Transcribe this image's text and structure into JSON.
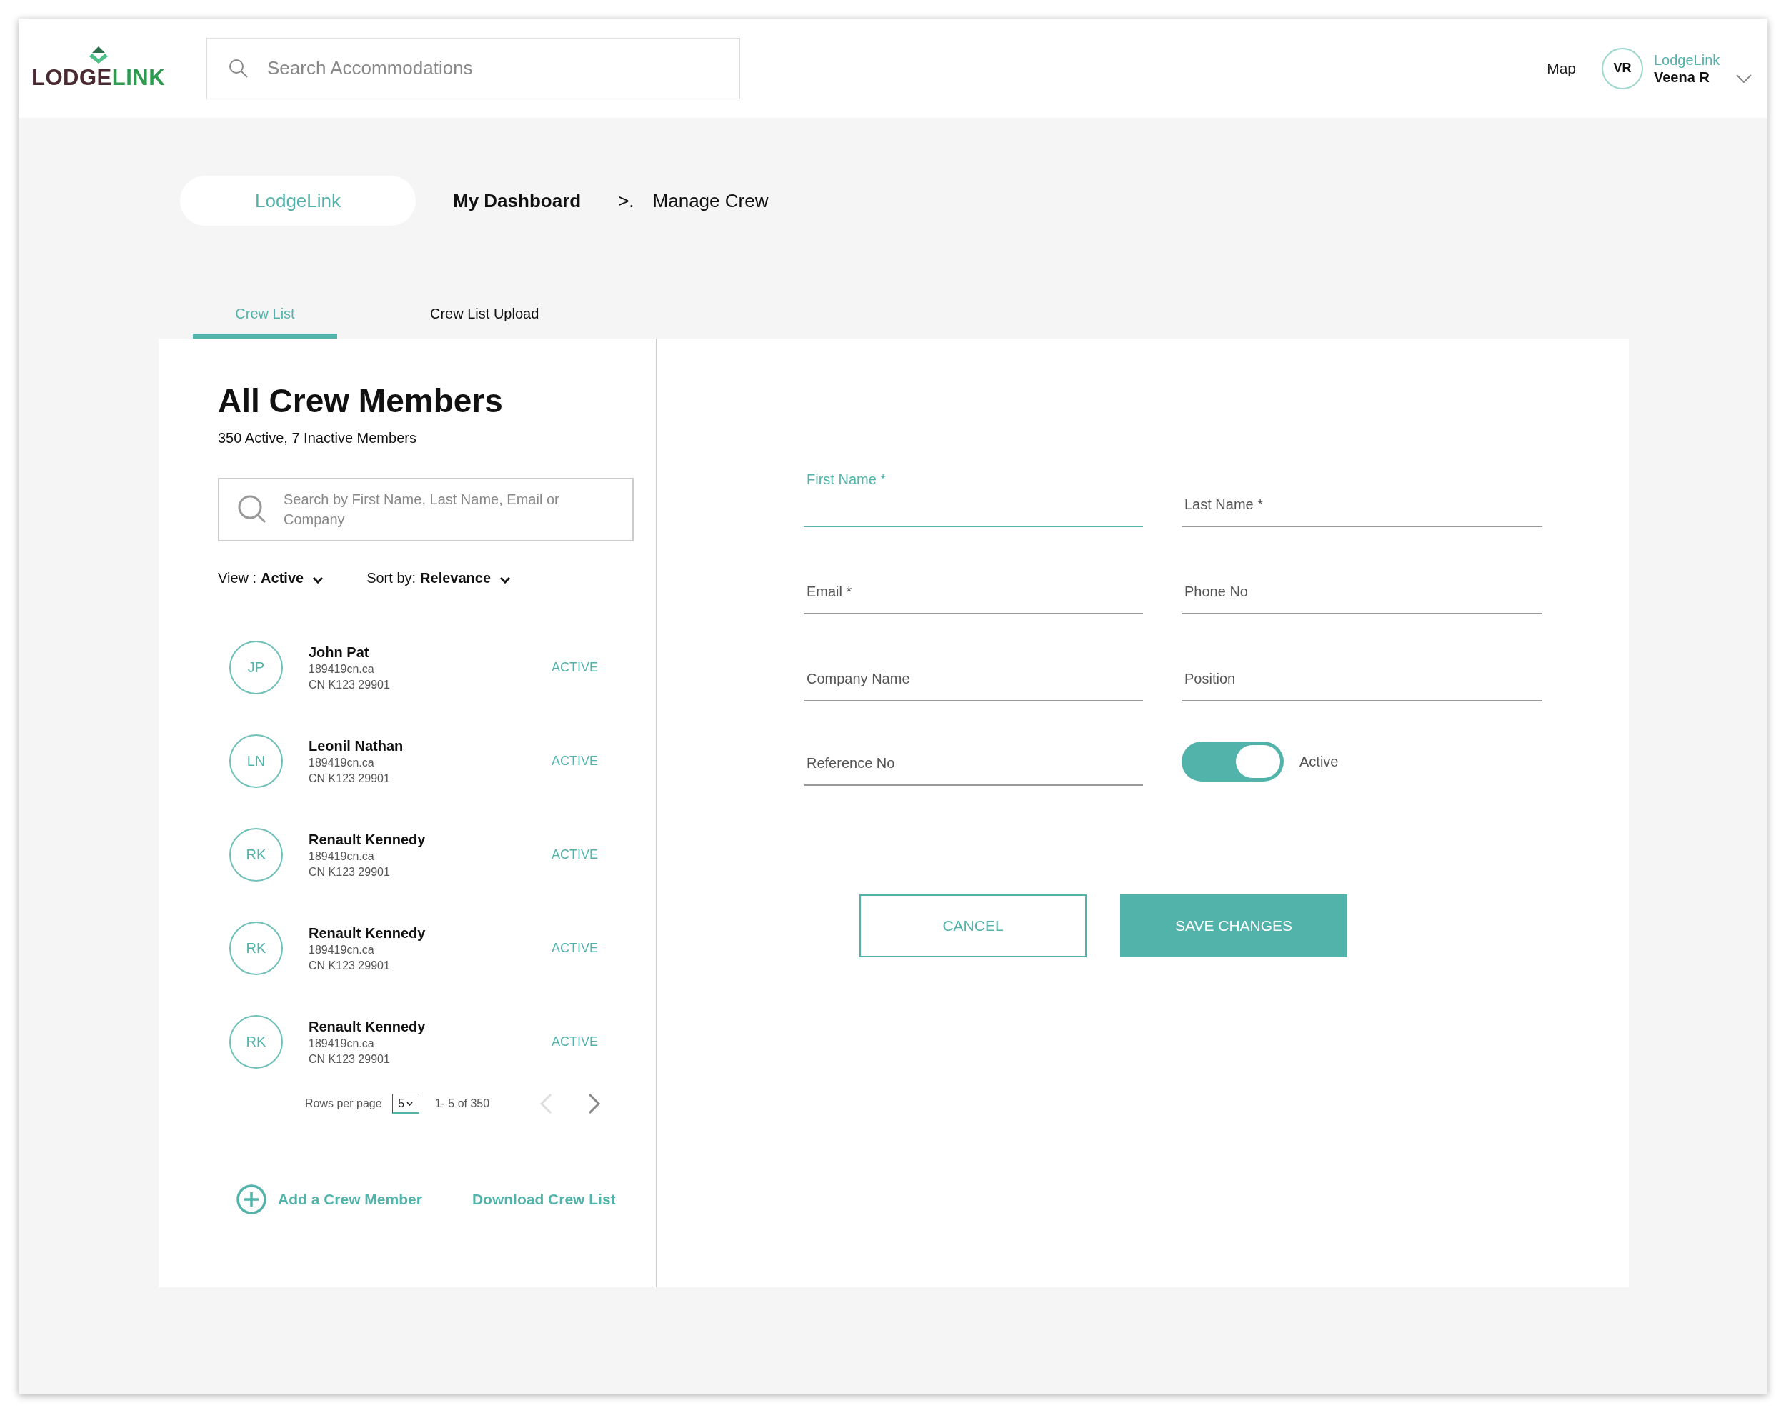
{
  "header": {
    "logo": {
      "part_1": "LODGE",
      "part_2": "LINK"
    },
    "search": {
      "placeholder": "Search Accommodations"
    },
    "map_link": "Map",
    "user": {
      "initials": "VR",
      "company": "LodgeLink",
      "name": "Veena R"
    }
  },
  "breadcrumb": {
    "home": "LodgeLink",
    "items": [
      "My Dashboard",
      ">.",
      "Manage Crew"
    ]
  },
  "tabs": [
    {
      "label": "Crew List",
      "selected": true
    },
    {
      "label": "Crew List Upload",
      "selected": false
    }
  ],
  "crew": {
    "title": "All Crew Members",
    "summary": "350 Active, 7 Inactive Members",
    "search": {
      "placeholder": "Search by First Name, Last Name, Email or Company"
    },
    "view": {
      "label": "View :",
      "value": "Active"
    },
    "sort": {
      "label": "Sort by:",
      "value": "Relevance"
    },
    "members": [
      {
        "initials": "JP",
        "name": "John Pat",
        "email": "189419cn.ca",
        "code": "CN K123 29901",
        "status": "ACTIVE"
      },
      {
        "initials": "LN",
        "name": "Leonil Nathan",
        "email": "189419cn.ca",
        "code": "CN K123 29901",
        "status": "ACTIVE"
      },
      {
        "initials": "RK",
        "name": "Renault Kennedy",
        "email": "189419cn.ca",
        "code": "CN K123 29901",
        "status": "ACTIVE"
      },
      {
        "initials": "RK",
        "name": "Renault Kennedy",
        "email": "189419cn.ca",
        "code": "CN K123 29901",
        "status": "ACTIVE"
      },
      {
        "initials": "RK",
        "name": "Renault Kennedy",
        "email": "189419cn.ca",
        "code": "CN K123 29901",
        "status": "ACTIVE"
      }
    ],
    "pagination": {
      "rows_label": "Rows per page",
      "rows_value": "5",
      "range": "1- 5 of 350",
      "prev_disabled": true,
      "next_disabled": false
    },
    "add_link": "Add a Crew Member",
    "download_link": "Download Crew List"
  },
  "form": {
    "fields": [
      {
        "label": "First Name *",
        "focused": true
      },
      {
        "label": "Last Name *",
        "focused": false
      },
      {
        "label": "Email *",
        "focused": false
      },
      {
        "label": "Phone No",
        "focused": false
      },
      {
        "label": "Company Name",
        "focused": false
      },
      {
        "label": "Position",
        "focused": false
      },
      {
        "label": "Reference No",
        "focused": false
      }
    ],
    "toggle": {
      "label": "Active",
      "on": true
    },
    "buttons": [
      {
        "label": "CANCEL",
        "kind": "secondary"
      },
      {
        "label": "SAVE CHANGES",
        "kind": "primary"
      }
    ]
  }
}
